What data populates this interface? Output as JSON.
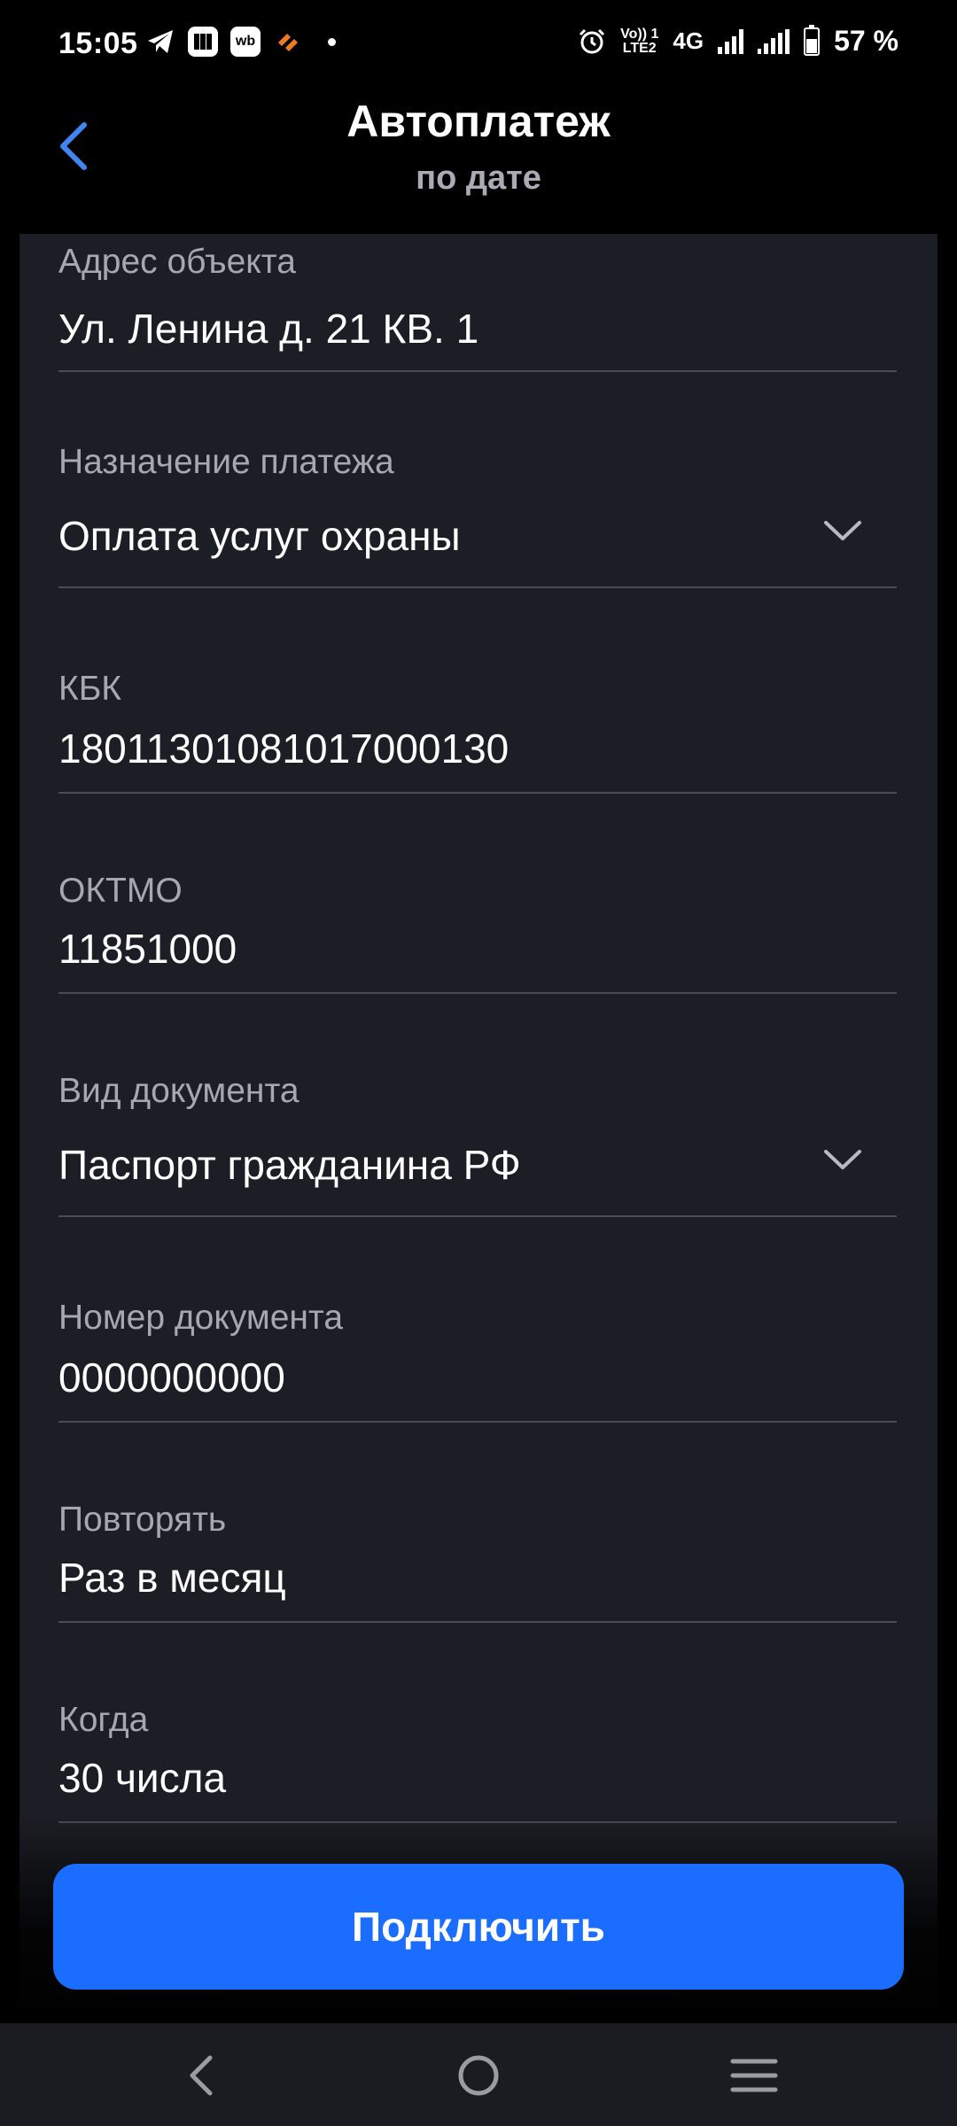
{
  "status_bar": {
    "time": "15:05",
    "app_badges": [
      "wb"
    ],
    "volte_line1": "Vo)) 1",
    "volte_line2": "LTE2",
    "network": "4G",
    "battery": "57 %",
    "battery_level": 0.57
  },
  "header": {
    "title": "Автоплатеж",
    "subtitle": "по дате"
  },
  "form": {
    "fields": [
      {
        "label": "Адрес объекта",
        "value": "Ул. Ленина д. 21 КВ. 1"
      },
      {
        "label": "Назначение платежа",
        "value": "Оплата услуг охраны",
        "dropdown": true
      },
      {
        "label": "КБК",
        "value": "18011301081017000130"
      },
      {
        "label": "ОКТМО",
        "value": "11851000"
      },
      {
        "label": "Вид документа",
        "value": "Паспорт гражданина РФ",
        "dropdown": true
      },
      {
        "label": "Номер документа",
        "value": "0000000000"
      },
      {
        "label": "Повторять",
        "value": "Раз в месяц"
      },
      {
        "label": "Когда",
        "value": "30 числа"
      }
    ]
  },
  "actions": {
    "connect_label": "Подключить"
  },
  "colors": {
    "accent": "#1a6dff",
    "back_icon": "#3f86f4",
    "card_bg": "#1c1e25",
    "label": "#a6a8b0"
  }
}
